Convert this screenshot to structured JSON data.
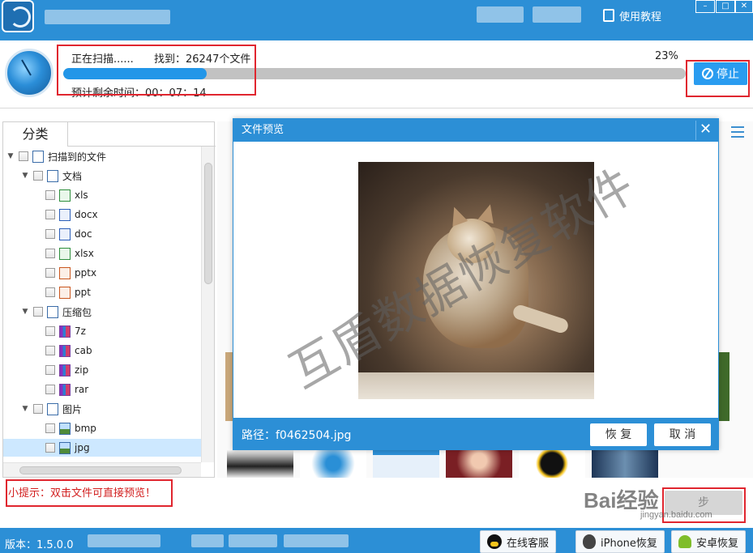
{
  "window": {
    "help_label": "使用教程",
    "minimize_icon": "minimize-icon",
    "close_icon": "close-icon"
  },
  "scan": {
    "status": "正在扫描......",
    "found": "找到：26247个文件",
    "percent": "23%",
    "progress": 0.23,
    "remaining": "预计剩余时间：00：07：14",
    "stop_label": "停止"
  },
  "tabs": {
    "category": "分类"
  },
  "tree": [
    {
      "label": "扫描到的文件",
      "level": 0,
      "icon": "list-icon",
      "toggle": "▼"
    },
    {
      "label": "文档",
      "level": 1,
      "icon": "document-icon",
      "toggle": "▼"
    },
    {
      "label": "xls",
      "level": 2,
      "icon": "xls-icon"
    },
    {
      "label": "docx",
      "level": 2,
      "icon": "docx-icon"
    },
    {
      "label": "doc",
      "level": 2,
      "icon": "doc-icon"
    },
    {
      "label": "xlsx",
      "level": 2,
      "icon": "xlsx-icon"
    },
    {
      "label": "pptx",
      "level": 2,
      "icon": "pptx-icon"
    },
    {
      "label": "ppt",
      "level": 2,
      "icon": "ppt-icon"
    },
    {
      "label": "压缩包",
      "level": 1,
      "icon": "archive-icon",
      "toggle": "▼"
    },
    {
      "label": "7z",
      "level": 2,
      "icon": "7z-icon"
    },
    {
      "label": "cab",
      "level": 2,
      "icon": "cab-icon"
    },
    {
      "label": "zip",
      "level": 2,
      "icon": "zip-icon"
    },
    {
      "label": "rar",
      "level": 2,
      "icon": "rar-icon"
    },
    {
      "label": "图片",
      "level": 1,
      "icon": "image-folder-icon",
      "toggle": "▼"
    },
    {
      "label": "bmp",
      "level": 2,
      "icon": "bmp-icon"
    },
    {
      "label": "jpg",
      "level": 2,
      "icon": "jpg-icon",
      "selected": true
    }
  ],
  "preview": {
    "title": "文件预览",
    "close": "✕",
    "watermark": "互盾数据恢复软件",
    "path": "路径：f0462504.jpg",
    "recover_label": "恢 复",
    "cancel_label": "取 消"
  },
  "hint": "小提示：双击文件可直接预览！",
  "next_label": "步",
  "baidu": {
    "mark": "Bai经验",
    "url": "jingyan.baidu.com"
  },
  "statusbar": {
    "version": "版本：1.5.0.0",
    "online_service": "在线客服",
    "iphone_recover": "iPhone恢复",
    "android_recover": "安卓恢复"
  },
  "colors": {
    "brand_blue": "#2c8fd6",
    "progress_blue": "#2296e8",
    "highlight_red": "#e0262f",
    "selected_row": "#cde8ff"
  }
}
